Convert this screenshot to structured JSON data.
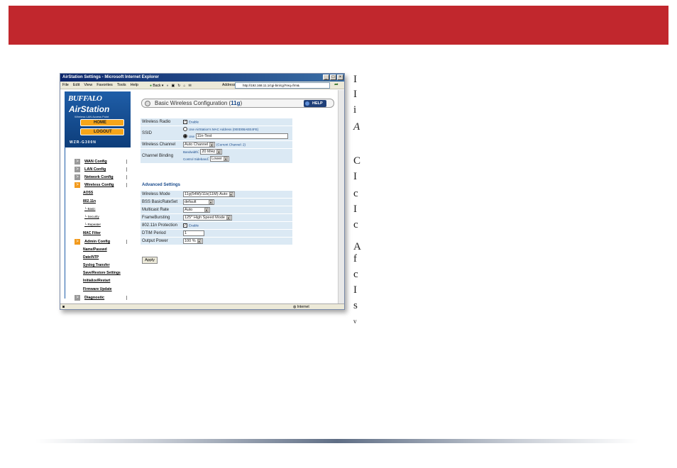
{
  "window": {
    "title": "AirStation Settings - Microsoft Internet Explorer",
    "menu": [
      "File",
      "Edit",
      "View",
      "Favorites",
      "Tools",
      "Help"
    ],
    "back_label": "Back",
    "address_label": "Address",
    "address_value": "http://192.168.11.1/cgi-bin/cgi?req=frm&",
    "status_zone": "Internet"
  },
  "nav": {
    "brand": "BUFFALO",
    "product": "AirStation",
    "subtitle": "Wireless LAN Access Point",
    "home": "HOME",
    "logout": "LOGOUT",
    "model": "WZR-G300N",
    "wan": "WAN Config",
    "lan": "LAN Config",
    "network": "Network Config",
    "wireless": "Wireless Config",
    "aoss": "AOSS",
    "std": "802.11n",
    "basic": "Basic",
    "security": "Security",
    "repeater": "Repeater",
    "mac": "MAC Filter",
    "admin": "Admin Config",
    "name_pw": "Name/Passwd",
    "date": "Date/NTP",
    "syslog": "Syslog Transfer",
    "saverestore": "Save/Restore Settings",
    "init": "Initialize/Restart",
    "firmware": "Firmware Update",
    "diag": "Diagnostic"
  },
  "main": {
    "header_text": "Basic Wireless Configuration (",
    "header_highlight": "11g",
    "header_close": ")",
    "help": "HELP",
    "radio_label": "Wireless Radio",
    "radio_value": "Enable",
    "ssid_label": "SSID",
    "ssid_opt1": "Use AirStation's MAC Address (000D0BAEE4FE)",
    "ssid_opt2": "Use",
    "ssid_value": "11n-Test",
    "channel_label": "Wireless Channel",
    "channel_value": "Auto Channel",
    "channel_current": "(Current Channel: 2)",
    "binding_label": "Channel Binding",
    "bandwidth_label": "Bandwidth",
    "bandwidth_value": "20 MHz",
    "sideband_label": "Control Sideband",
    "sideband_value": "Lower",
    "advanced_title": "Advanced Settings",
    "mode_label": "Wireless Mode",
    "mode_value": "11g(54M)/11b(11M)-Auto",
    "bss_label": "BSS BasicRateSet",
    "bss_value": "default",
    "mcast_label": "Multicast Rate",
    "mcast_value": "Auto",
    "frame_label": "FrameBursting",
    "frame_value": "125* High Speed Mode",
    "prot_label": "802.11n Protection",
    "prot_value": "Enable",
    "dtim_label": "DTIM Period",
    "dtim_value": "1",
    "power_label": "Output Power",
    "power_value": "100 %",
    "apply": "Apply"
  },
  "side_text": [
    "I",
    "I",
    "i",
    "A",
    "C",
    "I",
    "c",
    "I",
    "c",
    "A",
    "f",
    "c",
    "I",
    "s",
    "v"
  ]
}
